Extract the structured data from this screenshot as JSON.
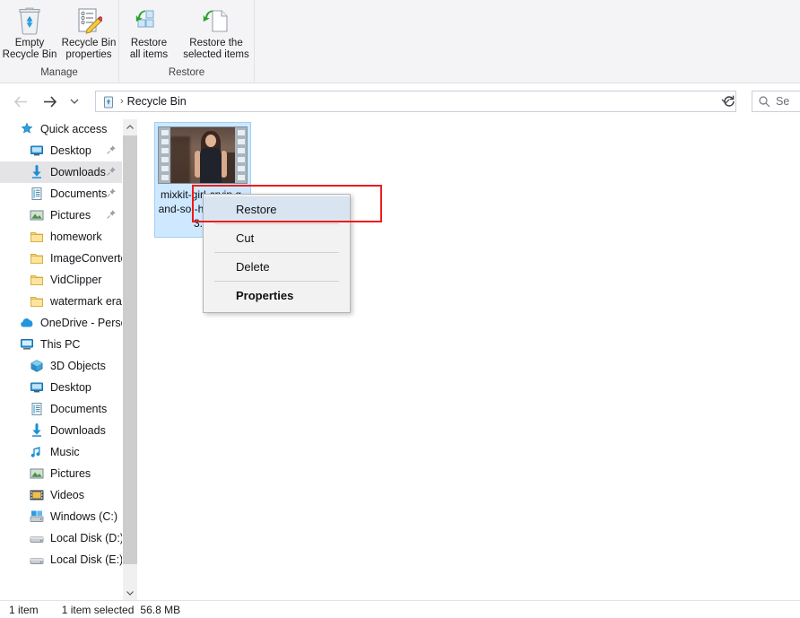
{
  "window": {
    "title": "Recycle Bin"
  },
  "ribbon": {
    "groups": [
      {
        "label": "Manage",
        "buttons": [
          {
            "label": "Empty\nRecycle Bin",
            "icon": "recycle-bin-icon",
            "name": "empty-recycle-bin-button"
          },
          {
            "label": "Recycle Bin\nproperties",
            "icon": "properties-icon",
            "name": "recycle-bin-properties-button"
          }
        ]
      },
      {
        "label": "Restore",
        "buttons": [
          {
            "label": "Restore\nall items",
            "icon": "restore-all-icon",
            "name": "restore-all-items-button"
          },
          {
            "label": "Restore the\nselected items",
            "icon": "restore-selected-icon",
            "name": "restore-selected-items-button"
          }
        ]
      }
    ]
  },
  "address": {
    "back_icon": "back-arrow-icon",
    "forward_icon": "forward-arrow-icon",
    "recent_icon": "chevron-down-icon",
    "up_icon": "up-arrow-icon",
    "path_icon": "recycle-bin-small-icon",
    "separator": "›",
    "path_text": "Recycle Bin",
    "dropdown_icon": "chevron-down-icon",
    "refresh_icon": "refresh-icon",
    "search_icon": "search-icon",
    "search_placeholder": "Se"
  },
  "sidebar": {
    "scroll_up_icon": "chevron-up-icon",
    "scroll_down_icon": "chevron-down-icon",
    "items": [
      {
        "label": "Quick access",
        "icon": "star-pin-icon",
        "indent": 0,
        "selected": false,
        "pinned": false
      },
      {
        "label": "Desktop",
        "icon": "desktop-icon",
        "indent": 1,
        "selected": false,
        "pinned": true
      },
      {
        "label": "Downloads",
        "icon": "downloads-icon",
        "indent": 1,
        "selected": true,
        "pinned": true
      },
      {
        "label": "Documents",
        "icon": "documents-icon",
        "indent": 1,
        "selected": false,
        "pinned": true
      },
      {
        "label": "Pictures",
        "icon": "pictures-icon",
        "indent": 1,
        "selected": false,
        "pinned": true
      },
      {
        "label": "homework",
        "icon": "folder-icon",
        "indent": 1,
        "selected": false,
        "pinned": false
      },
      {
        "label": "ImageConverter",
        "icon": "folder-icon",
        "indent": 1,
        "selected": false,
        "pinned": false
      },
      {
        "label": "VidClipper",
        "icon": "folder-icon",
        "indent": 1,
        "selected": false,
        "pinned": false
      },
      {
        "label": "watermark erase",
        "icon": "folder-icon",
        "indent": 1,
        "selected": false,
        "pinned": false
      },
      {
        "label": "OneDrive - Person",
        "icon": "onedrive-icon",
        "indent": 0,
        "selected": false,
        "pinned": false
      },
      {
        "label": "This PC",
        "icon": "this-pc-icon",
        "indent": 0,
        "selected": false,
        "pinned": false
      },
      {
        "label": "3D Objects",
        "icon": "3d-objects-icon",
        "indent": 1,
        "selected": false,
        "pinned": false
      },
      {
        "label": "Desktop",
        "icon": "desktop-icon",
        "indent": 1,
        "selected": false,
        "pinned": false
      },
      {
        "label": "Documents",
        "icon": "documents-icon",
        "indent": 1,
        "selected": false,
        "pinned": false
      },
      {
        "label": "Downloads",
        "icon": "downloads-icon",
        "indent": 1,
        "selected": false,
        "pinned": false
      },
      {
        "label": "Music",
        "icon": "music-icon",
        "indent": 1,
        "selected": false,
        "pinned": false
      },
      {
        "label": "Pictures",
        "icon": "pictures-icon",
        "indent": 1,
        "selected": false,
        "pinned": false
      },
      {
        "label": "Videos",
        "icon": "videos-icon",
        "indent": 1,
        "selected": false,
        "pinned": false
      },
      {
        "label": "Windows (C:)",
        "icon": "windows-drive-icon",
        "indent": 1,
        "selected": false,
        "pinned": false
      },
      {
        "label": "Local Disk (D:)",
        "icon": "drive-icon",
        "indent": 1,
        "selected": false,
        "pinned": false
      },
      {
        "label": "Local Disk (E:)",
        "icon": "drive-icon",
        "indent": 1,
        "selected": false,
        "pinned": false
      }
    ]
  },
  "content": {
    "file": {
      "name": "mixkit-girl-cryin g-and-so -heartbro 53.m",
      "icon": "video-thumbnail",
      "selected": true
    }
  },
  "context_menu": {
    "items": [
      {
        "label": "Restore",
        "highlighted": true,
        "bold": false,
        "separator_after": true
      },
      {
        "label": "Cut",
        "highlighted": false,
        "bold": false,
        "separator_after": true
      },
      {
        "label": "Delete",
        "highlighted": false,
        "bold": false,
        "separator_after": true
      },
      {
        "label": "Properties",
        "highlighted": false,
        "bold": true,
        "separator_after": false
      }
    ]
  },
  "annotation": {
    "color": "#ef1b1b",
    "shape": "rectangle"
  },
  "statusbar": {
    "item_count": "1 item",
    "selection": "1 item selected",
    "size": "56.8 MB"
  }
}
